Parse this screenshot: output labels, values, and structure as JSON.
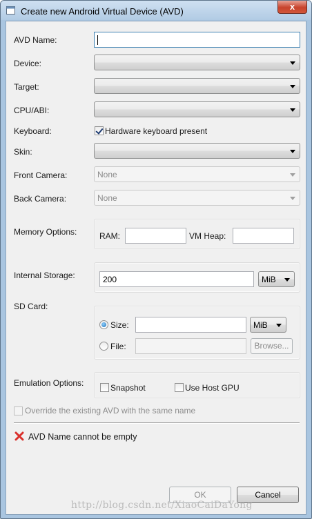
{
  "window": {
    "title": "Create new Android Virtual Device (AVD)",
    "close": "x"
  },
  "form": {
    "avd_name": {
      "label": "AVD Name:",
      "value": ""
    },
    "device": {
      "label": "Device:",
      "value": ""
    },
    "target": {
      "label": "Target:",
      "value": ""
    },
    "cpu_abi": {
      "label": "CPU/ABI:",
      "value": ""
    },
    "keyboard": {
      "label": "Keyboard:",
      "checkbox_label": "Hardware keyboard present",
      "checked": true
    },
    "skin": {
      "label": "Skin:",
      "value": ""
    },
    "front_camera": {
      "label": "Front Camera:",
      "value": "None"
    },
    "back_camera": {
      "label": "Back Camera:",
      "value": "None"
    },
    "memory": {
      "label": "Memory Options:",
      "ram_label": "RAM:",
      "ram_value": "",
      "vm_heap_label": "VM Heap:",
      "vm_heap_value": ""
    },
    "internal_storage": {
      "label": "Internal Storage:",
      "value": "200",
      "unit": "MiB"
    },
    "sd_card": {
      "label": "SD Card:",
      "size_label": "Size:",
      "size_value": "",
      "size_unit": "MiB",
      "size_selected": true,
      "file_label": "File:",
      "file_value": "",
      "browse_label": "Browse..."
    },
    "emulation": {
      "label": "Emulation Options:",
      "snapshot_label": "Snapshot",
      "snapshot_checked": false,
      "host_gpu_label": "Use Host GPU",
      "host_gpu_checked": false
    },
    "override": {
      "label": "Override the existing AVD with the same name",
      "checked": false
    }
  },
  "error": {
    "icon": "error-x-icon",
    "message": "AVD Name cannot be empty",
    "color": "#d9302c"
  },
  "buttons": {
    "ok": "OK",
    "cancel": "Cancel"
  },
  "watermark": "http://blog.csdn.net/XiaoCaiDaYong"
}
